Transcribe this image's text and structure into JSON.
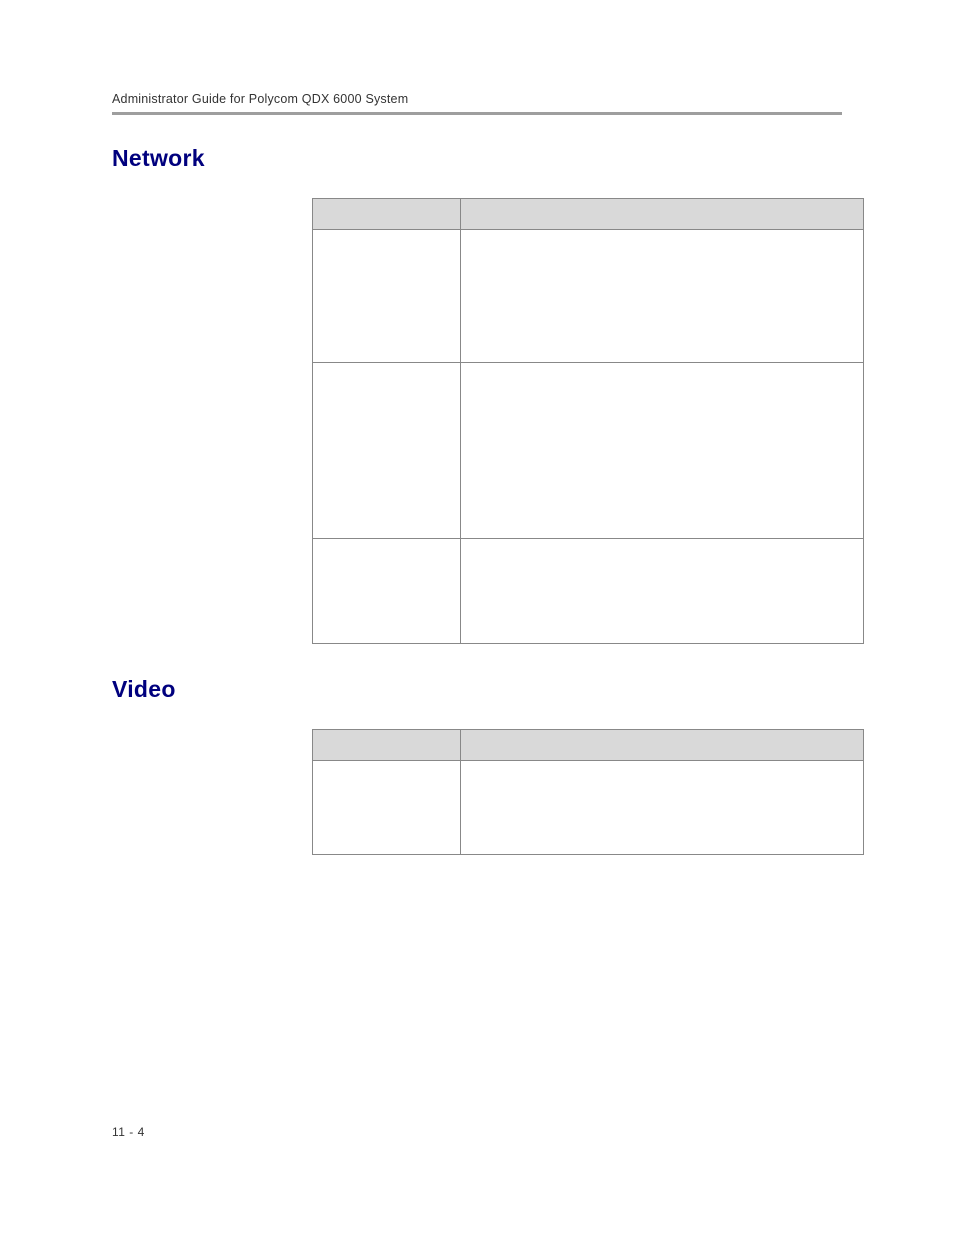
{
  "header": {
    "title": "Administrator Guide for Polycom QDX 6000 System"
  },
  "sections": {
    "network": {
      "title": "Network"
    },
    "video": {
      "title": "Video"
    }
  },
  "page_number": "11 - 4"
}
